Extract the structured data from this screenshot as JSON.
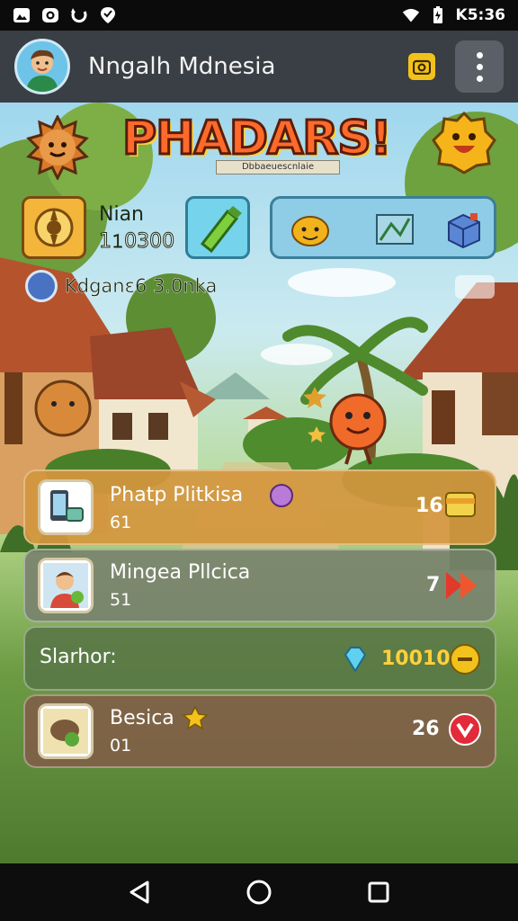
{
  "status_bar": {
    "left_icons": [
      "photo-icon",
      "camera-icon",
      "sync-icon",
      "location-icon"
    ],
    "right_icons": [
      "wifi-icon",
      "battery-icon"
    ],
    "time": "K5:36"
  },
  "app_bar": {
    "title": "Nngalh Mdnesia",
    "camera_icon": "camera-icon",
    "menu_icon": "more-vertical-icon"
  },
  "game": {
    "logo_title": "PHADARS!",
    "logo_subtitle": "Dbbaeuescnlaie",
    "player": {
      "name": "Nian",
      "value": "1𝟷0300"
    },
    "location_text": "Kdganɛ6 3.0nka",
    "items": [
      "smiley-icon",
      "map-icon",
      "crate-icon"
    ],
    "colors": {
      "accent_orange": "#ff6a2b",
      "panel_gold": "#d4963e",
      "panel_green": "#5a7846"
    }
  },
  "list": [
    {
      "title": "Phatp Plitkisa",
      "sub": "61",
      "count": "16",
      "icon": "phone-icon",
      "trail": "canister-icon"
    },
    {
      "title": "Mingea Pllcica",
      "sub": "51",
      "count": "7",
      "icon": "avatar-icon",
      "trail": "fast-forward-icon"
    },
    {
      "title": "Slarhor:",
      "amount": "10010",
      "icon": "diamond-icon",
      "trail": "plus-coin-icon"
    },
    {
      "title": "Besica",
      "sub": "01",
      "count": "26",
      "icon": "map-pouch-icon",
      "trail": "arrow-down-icon"
    }
  ],
  "actions": [
    {
      "name": "pencil",
      "color": "#6cc83c"
    },
    {
      "name": "phone",
      "color": "#f6a41c"
    },
    {
      "name": "chat",
      "color": "#e24a2c"
    },
    {
      "name": "ticket",
      "color": "#2fbe3c"
    },
    {
      "name": "camera",
      "color": "#5e3fc6"
    }
  ],
  "nav": [
    "back-icon",
    "home-icon",
    "recents-icon"
  ]
}
